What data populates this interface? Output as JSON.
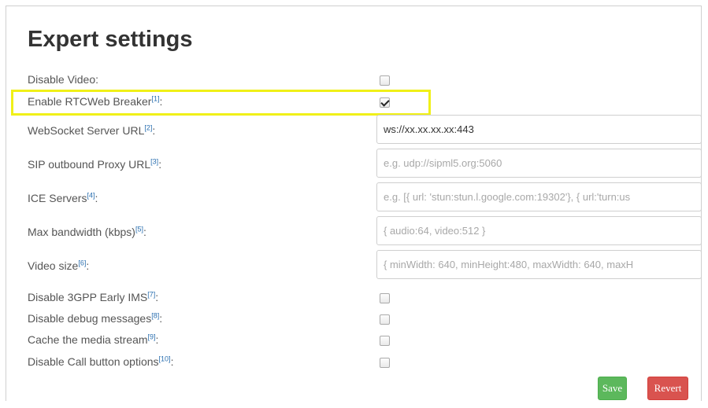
{
  "title": "Expert settings",
  "fields": {
    "disable_video": {
      "label": "Disable Video",
      "ref": "",
      "colon": ":",
      "checked": false
    },
    "enable_rtcweb_breaker": {
      "label": "Enable RTCWeb Breaker",
      "ref": "[1]",
      "colon": ":",
      "checked": true
    },
    "websocket_url": {
      "label": "WebSocket Server URL",
      "ref": "[2]",
      "colon": ":",
      "value": "ws://xx.xx.xx.xx:443"
    },
    "sip_proxy_url": {
      "label": "SIP outbound Proxy URL",
      "ref": "[3]",
      "colon": ":",
      "placeholder": "e.g. udp://sipml5.org:5060"
    },
    "ice_servers": {
      "label": "ICE Servers",
      "ref": "[4]",
      "colon": ":",
      "placeholder": "e.g. [{ url: 'stun:stun.l.google.com:19302'}, { url:'turn:us"
    },
    "max_bandwidth": {
      "label": "Max bandwidth (kbps)",
      "ref": "[5]",
      "colon": ":",
      "placeholder": "{ audio:64, video:512 }"
    },
    "video_size": {
      "label": "Video size",
      "ref": "[6]",
      "colon": ":",
      "placeholder": "{ minWidth: 640, minHeight:480, maxWidth: 640, maxH"
    },
    "disable_3gpp": {
      "label": "Disable 3GPP Early IMS",
      "ref": "[7]",
      "colon": ":",
      "checked": false
    },
    "disable_debug": {
      "label": "Disable debug messages",
      "ref": "[8]",
      "colon": ":",
      "checked": false
    },
    "cache_media": {
      "label": "Cache the media stream",
      "ref": "[9]",
      "colon": ":",
      "checked": false
    },
    "disable_call_options": {
      "label": "Disable Call button options",
      "ref": "[10]",
      "colon": ":",
      "checked": false
    }
  },
  "buttons": {
    "save": "Save",
    "revert": "Revert"
  },
  "colors": {
    "highlight": "#f0f018",
    "save": "#5cb85c",
    "revert": "#d9534f",
    "link": "#2a6fb0"
  }
}
